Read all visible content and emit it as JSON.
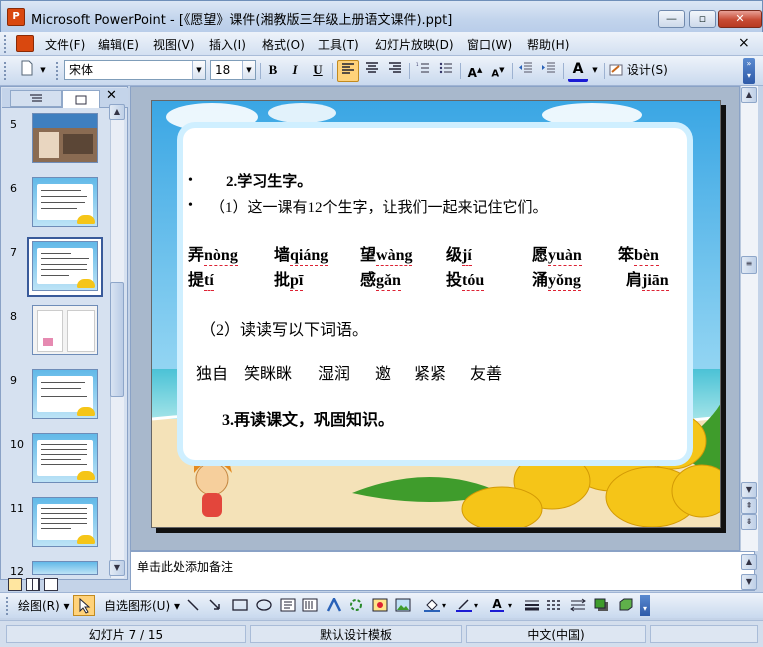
{
  "window": {
    "title": "Microsoft PowerPoint - [《愿望》课件(湘教版三年级上册语文课件).ppt]",
    "minimize": "—",
    "maximize": "▫",
    "close": "✕"
  },
  "menu": {
    "items": [
      "文件(F)",
      "编辑(E)",
      "视图(V)",
      "插入(I)",
      "格式(O)",
      "工具(T)",
      "幻灯片放映(D)",
      "窗口(W)",
      "帮助(H)"
    ],
    "close_doc": "×"
  },
  "format_toolbar": {
    "font_name": "宋体",
    "font_size": "18",
    "bold": "B",
    "italic": "I",
    "underline": "U",
    "design_label": "设计(S)"
  },
  "slides_pane": {
    "thumbnails": [
      "5",
      "6",
      "7",
      "8",
      "9",
      "10",
      "11",
      "12"
    ],
    "selected": "7"
  },
  "slide": {
    "heading1": "2.学习生字。",
    "line2": "（1）这一课有12个生字，让我们一起来记住它们。",
    "row1": [
      {
        "char": "弄",
        "pinyin": "nòng"
      },
      {
        "char": "墙",
        "pinyin": "qiáng"
      },
      {
        "char": "望",
        "pinyin": "wàng"
      },
      {
        "char": "级",
        "pinyin": "jí"
      },
      {
        "char": "愿",
        "pinyin": "yuàn"
      },
      {
        "char": "笨",
        "pinyin": "bèn"
      }
    ],
    "row2": [
      {
        "char": "提",
        "pinyin": " tí"
      },
      {
        "char": "批",
        "pinyin": "pī"
      },
      {
        "char": "感",
        "pinyin": "gǎn"
      },
      {
        "char": "投",
        "pinyin": "tóu"
      },
      {
        "char": "涌",
        "pinyin": "yǒng"
      },
      {
        "char": "肩",
        "pinyin": "jiān"
      }
    ],
    "line3": "（2）读读写以下词语。",
    "words": [
      "独自",
      "笑眯眯",
      "湿润",
      "邀",
      "紧紧",
      "友善"
    ],
    "heading2": "3.再读课文，巩固知识。"
  },
  "notes": {
    "placeholder": "单击此处添加备注"
  },
  "draw_toolbar": {
    "draw_label": "绘图(R)",
    "autoshapes_label": "自选图形(U)"
  },
  "status": {
    "slide_info": "幻灯片 7 / 15",
    "template": "默认设计模板",
    "language": "中文(中国)"
  },
  "colors": {
    "accent_selected": "#ffd27a",
    "sky": "#62b9e8",
    "fruit": "#f5c518"
  }
}
